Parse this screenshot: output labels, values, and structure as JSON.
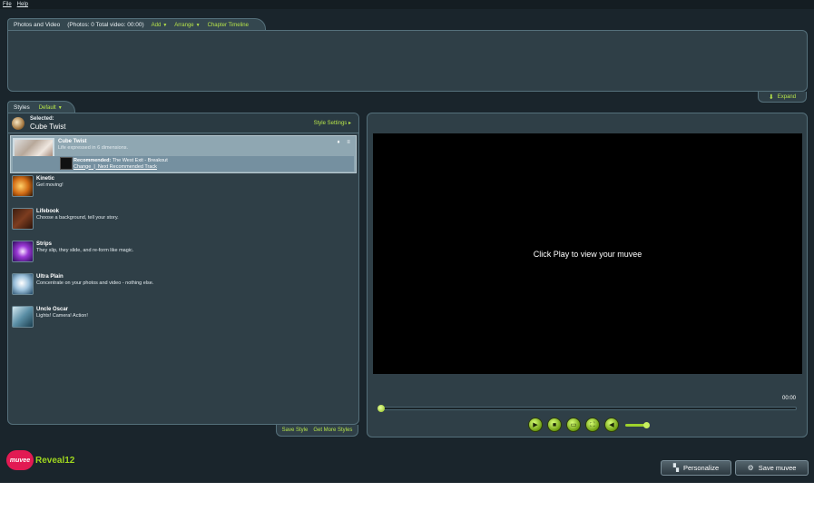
{
  "menu": {
    "file": "File",
    "help": "Help"
  },
  "photos": {
    "title": "Photos and Video",
    "stats": "(Photos: 0   Total video: 00:00)",
    "add": "Add",
    "arrange": "Arrange",
    "chapter_timeline": "Chapter Timeline",
    "expand": "Expand"
  },
  "styles": {
    "tab_title": "Styles",
    "preset": "Default",
    "selected_label": "Selected:",
    "selected_value": "Cube Twist",
    "style_settings": "Style Settings",
    "items": [
      {
        "name": "Cube Twist",
        "desc": "Life expressed in 6 dimensions.",
        "recommended": "Recommended:",
        "track": "The West Exit - Breakout",
        "change": "Change",
        "next_track": "Next Recommended Track"
      },
      {
        "name": "Kinetic",
        "desc": "Get moving!"
      },
      {
        "name": "Lifebook",
        "desc": "Choose a background, tell your story."
      },
      {
        "name": "Strips",
        "desc": "They slip, they slide, and re-form like magic."
      },
      {
        "name": "Ultra Plain",
        "desc": "Concentrate on your photos and video - nothing else."
      },
      {
        "name": "Uncle Oscar",
        "desc": "Lights! Camera! Action!"
      }
    ],
    "save_style": "Save Style",
    "get_more": "Get More Styles"
  },
  "preview": {
    "message": "Click Play to view your muvee",
    "timecode": "00:00",
    "progress": 0,
    "volume": 0.8
  },
  "logo": {
    "mark": "muvee",
    "text": "Reveal12"
  },
  "buttons": {
    "personalize": "Personalize",
    "save": "Save muvee"
  },
  "colors": {
    "accent": "#b6e34a",
    "panel": "#2f3f47",
    "background": "#1a252c",
    "logo": "#e21a53"
  }
}
